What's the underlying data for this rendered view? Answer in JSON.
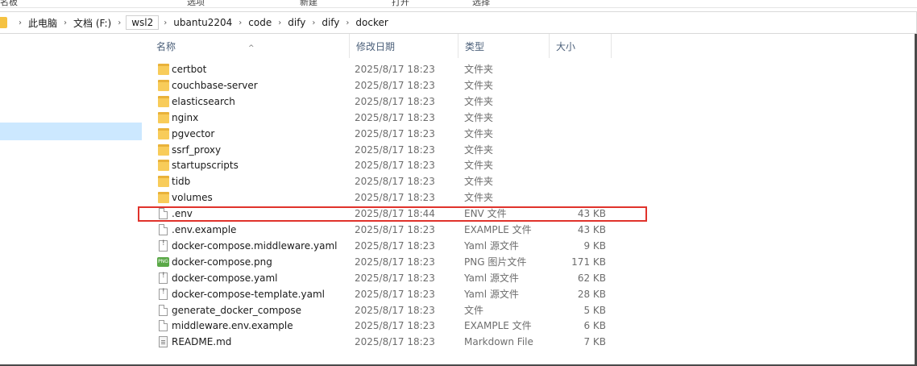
{
  "ribbon": {
    "labels": [
      "名板",
      "选项",
      "新建",
      "打开",
      "选择"
    ]
  },
  "breadcrumb": {
    "items": [
      "此电脑",
      "文档 (F:)",
      "wsl2",
      "ubantu2204",
      "code",
      "dify",
      "dify",
      "docker"
    ]
  },
  "columns": {
    "name": "名称",
    "date": "修改日期",
    "type": "类型",
    "size": "大小"
  },
  "files": [
    {
      "name": "certbot",
      "date": "2025/8/17 18:23",
      "type": "文件夹",
      "size": "",
      "icon": "folder-icon"
    },
    {
      "name": "couchbase-server",
      "date": "2025/8/17 18:23",
      "type": "文件夹",
      "size": "",
      "icon": "folder-icon"
    },
    {
      "name": "elasticsearch",
      "date": "2025/8/17 18:23",
      "type": "文件夹",
      "size": "",
      "icon": "folder-icon"
    },
    {
      "name": "nginx",
      "date": "2025/8/17 18:23",
      "type": "文件夹",
      "size": "",
      "icon": "folder-icon"
    },
    {
      "name": "pgvector",
      "date": "2025/8/17 18:23",
      "type": "文件夹",
      "size": "",
      "icon": "folder-icon"
    },
    {
      "name": "ssrf_proxy",
      "date": "2025/8/17 18:23",
      "type": "文件夹",
      "size": "",
      "icon": "folder-icon"
    },
    {
      "name": "startupscripts",
      "date": "2025/8/17 18:23",
      "type": "文件夹",
      "size": "",
      "icon": "folder-icon"
    },
    {
      "name": "tidb",
      "date": "2025/8/17 18:23",
      "type": "文件夹",
      "size": "",
      "icon": "folder-icon"
    },
    {
      "name": "volumes",
      "date": "2025/8/17 18:23",
      "type": "文件夹",
      "size": "",
      "icon": "folder-icon"
    },
    {
      "name": ".env",
      "date": "2025/8/17 18:44",
      "type": "ENV 文件",
      "size": "43 KB",
      "icon": "file-icon"
    },
    {
      "name": ".env.example",
      "date": "2025/8/17 18:23",
      "type": "EXAMPLE 文件",
      "size": "43 KB",
      "icon": "file-icon"
    },
    {
      "name": "docker-compose.middleware.yaml",
      "date": "2025/8/17 18:23",
      "type": "Yaml 源文件",
      "size": "9 KB",
      "icon": "yaml-file-icon"
    },
    {
      "name": "docker-compose.png",
      "date": "2025/8/17 18:23",
      "type": "PNG 图片文件",
      "size": "171 KB",
      "icon": "png-file-icon"
    },
    {
      "name": "docker-compose.yaml",
      "date": "2025/8/17 18:23",
      "type": "Yaml 源文件",
      "size": "62 KB",
      "icon": "yaml-file-icon"
    },
    {
      "name": "docker-compose-template.yaml",
      "date": "2025/8/17 18:23",
      "type": "Yaml 源文件",
      "size": "28 KB",
      "icon": "yaml-file-icon"
    },
    {
      "name": "generate_docker_compose",
      "date": "2025/8/17 18:23",
      "type": "文件",
      "size": "5 KB",
      "icon": "file-icon"
    },
    {
      "name": "middleware.env.example",
      "date": "2025/8/17 18:23",
      "type": "EXAMPLE 文件",
      "size": "6 KB",
      "icon": "file-icon"
    },
    {
      "name": "README.md",
      "date": "2025/8/17 18:23",
      "type": "Markdown File",
      "size": "7 KB",
      "icon": "markdown-file-icon"
    }
  ],
  "colors": {
    "highlight_border": "#e0332c",
    "nav_selected": "#cce8ff",
    "folder": "#f8cc5a"
  }
}
